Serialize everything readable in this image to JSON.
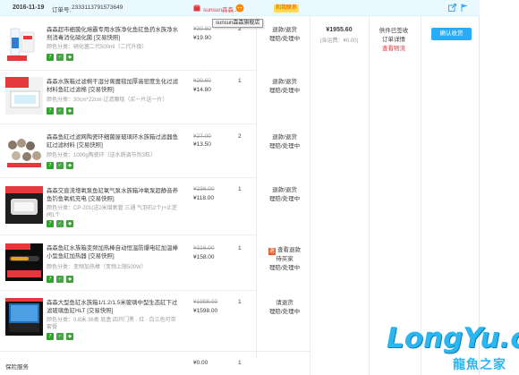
{
  "header": {
    "date": "2016-11-19",
    "order_no_label": "订单号:",
    "order_no": "2333113791573649",
    "shop_name": "sunsun森森...",
    "badge": "和我联系",
    "tooltip": "sunsun森森旗舰店"
  },
  "items": [
    {
      "title": "森森超市细菌化熔霸专用水族净化鱼缸鱼药水族净水剂消毒消化硝化菌 [交易快照]",
      "sku": "颜色分类：硝化菌二代500ml（二代升级）",
      "orig_price": "¥39.80",
      "price": "¥19.90",
      "qty": "2",
      "after_sale": [
        "退款/退货",
        "理赔/处理中"
      ]
    },
    {
      "title": "森森水族箱过滤棉干湿分离魔毯加厚高密度生化过滤材料鱼缸过滤棉 [交易快照]",
      "sku": "颜色分类：30cm*22cm 过滤魔毯（买一片送一片）",
      "orig_price": "¥29.60",
      "price": "¥14.80",
      "qty": "1",
      "after_sale": [
        "退款/退货",
        "理赔/处理中"
      ]
    },
    {
      "title": "森森鱼缸过滤网陶瓷环细菌屋玻璃环水族箱过滤器鱼缸过滤材料 [交易快照]",
      "sku": "颜色分类：1000g陶瓷环（送水质调节剂3粒）",
      "orig_price": "¥27.00",
      "price": "¥13.50",
      "qty": "2",
      "after_sale": [
        "退款/退货",
        "理赔/处理中"
      ]
    },
    {
      "title": "森森交直流增氧泵鱼缸氧气泵水族箱冲氧泵超静音养鱼钓鱼氧机充电 [交易快照]",
      "sku": "颜色分类：CP-201(送2米增氧管 三通 气泡石2个)+止逆阀1个",
      "orig_price": "¥236.00",
      "price": "¥118.00",
      "qty": "1",
      "after_sale": [
        "退款/退货",
        "理赔/处理中"
      ]
    },
    {
      "title": "森森鱼缸水族箱变频加热棒自动恒温防爆电缸加温棒小型鱼缸加热器 [交易快照]",
      "sku": "颜色分类：变频加热棒（变频上限500W）",
      "orig_price": "¥316.00",
      "price": "¥158.00",
      "qty": "1",
      "refund_label": "查看退款",
      "after_sale": [
        "待买家",
        "理赔/处理中"
      ]
    },
    {
      "title": "森森大型鱼缸水族箱1/1.2/1.5米玻璃中型生态缸下过滤玻璃鱼缸HLT [交易快照]",
      "sku": "颜色分类：0.8米 36类 底盒 四开门黑 · 红 · 白三色可带套餐",
      "orig_price": "¥1998.00",
      "price": "¥1598.00",
      "qty": "1",
      "after_sale": [
        "请退货",
        "理赔/处理中"
      ]
    }
  ],
  "summary": {
    "total": "¥1955.60",
    "shipping": "(含运费：¥0.00)",
    "status_lines": [
      "供件已签收",
      "订单详情"
    ],
    "status_link": "查看物流",
    "confirm_button": "确认收货"
  },
  "footer": {
    "label": "保险服务",
    "price": "¥0.00",
    "qty": "1"
  },
  "watermark": {
    "text": "LongYu.cc",
    "sub": "龍魚之家"
  }
}
